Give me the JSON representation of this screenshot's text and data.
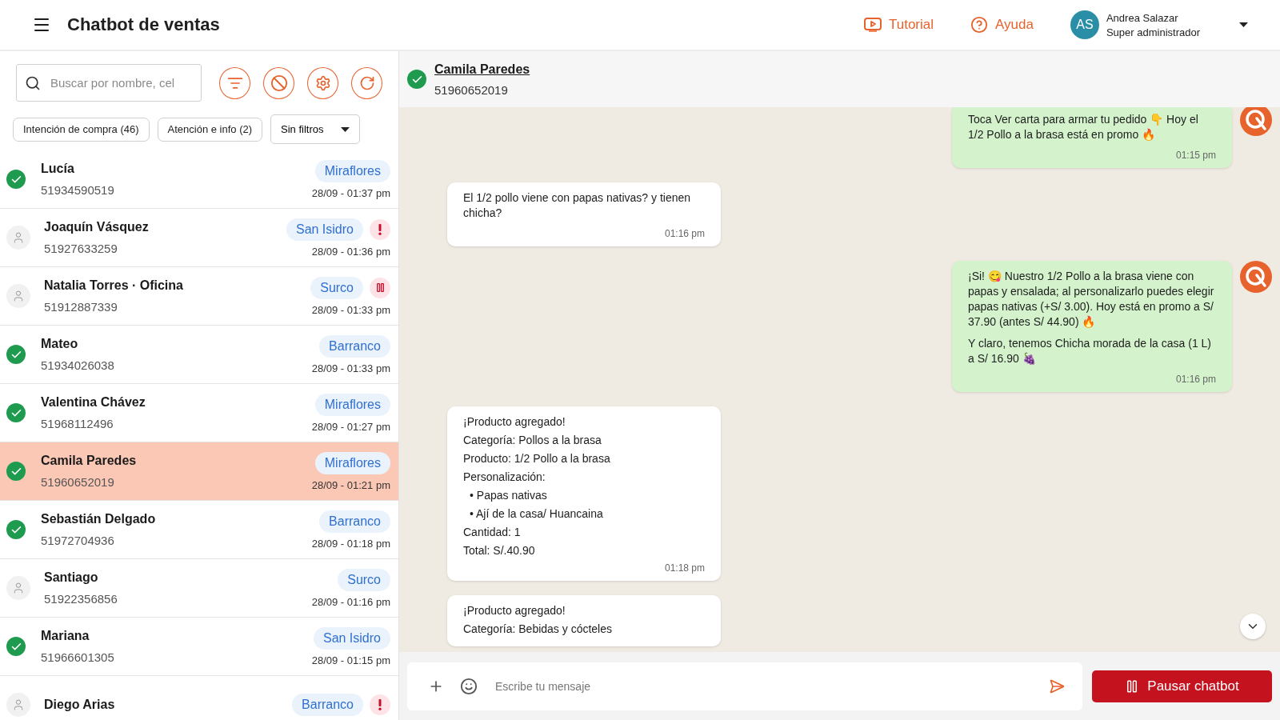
{
  "header": {
    "title": "Chatbot de ventas",
    "links": [
      {
        "kind": "tutorial",
        "label": "Tutorial"
      },
      {
        "kind": "help",
        "label": "Ayuda"
      }
    ],
    "user": {
      "initials": "AS",
      "name": "Andrea Salazar",
      "role": "Super administrador"
    }
  },
  "sidebar": {
    "search": {
      "placeholder": "Buscar por nombre, cel"
    },
    "chips": [
      {
        "label": "Intención de compra (46)"
      },
      {
        "label": "Atención e info (2)"
      }
    ],
    "filter_select": {
      "value": "Sin filtros"
    },
    "contacts": [
      {
        "name": "Lucía",
        "phone": "51934590519",
        "district": "Miraflores",
        "time": "28/09 - 01:37 pm",
        "kind": "bot",
        "alert": false,
        "paused": false,
        "selected": false
      },
      {
        "name": "Joaquín Vásquez",
        "phone": "51927633259",
        "district": "San Isidro",
        "time": "28/09 - 01:36 pm",
        "kind": "human",
        "alert": true,
        "paused": false,
        "selected": false
      },
      {
        "name": "Natalia Torres · Oficina",
        "phone": "51912887339",
        "district": "Surco",
        "time": "28/09 - 01:33 pm",
        "kind": "human",
        "alert": false,
        "paused": true,
        "selected": false
      },
      {
        "name": "Mateo",
        "phone": "51934026038",
        "district": "Barranco",
        "time": "28/09 - 01:33 pm",
        "kind": "bot",
        "alert": false,
        "paused": false,
        "selected": false
      },
      {
        "name": "Valentina Chávez",
        "phone": "51968112496",
        "district": "Miraflores",
        "time": "28/09 - 01:27 pm",
        "kind": "bot",
        "alert": false,
        "paused": false,
        "selected": false
      },
      {
        "name": "Camila Paredes",
        "phone": "51960652019",
        "district": "Miraflores",
        "time": "28/09 - 01:21 pm",
        "kind": "bot",
        "alert": false,
        "paused": false,
        "selected": true
      },
      {
        "name": "Sebastián Delgado",
        "phone": "51972704936",
        "district": "Barranco",
        "time": "28/09 - 01:18 pm",
        "kind": "bot",
        "alert": false,
        "paused": false,
        "selected": false
      },
      {
        "name": "Santiago",
        "phone": "51922356856",
        "district": "Surco",
        "time": "28/09 - 01:16 pm",
        "kind": "human",
        "alert": false,
        "paused": false,
        "selected": false
      },
      {
        "name": "Mariana",
        "phone": "51966601305",
        "district": "San Isidro",
        "time": "28/09 - 01:15 pm",
        "kind": "bot",
        "alert": false,
        "paused": false,
        "selected": false
      },
      {
        "name": "Diego Arias",
        "district": "Barranco",
        "kind": "human",
        "alert": true,
        "paused": false,
        "selected": false
      }
    ]
  },
  "chat": {
    "contact": {
      "name": "Camila Paredes",
      "phone": "51960652019",
      "kind": "bot"
    },
    "messages": [
      {
        "kind": "bot",
        "blocks": [
          {
            "kind": "paragraph",
            "text": "Toca Ver carta para armar tu pedido 👇 Hoy el 1/2 Pollo a la brasa está en promo 🔥"
          }
        ],
        "time": "01:15 pm"
      },
      {
        "kind": "user",
        "blocks": [
          {
            "kind": "paragraph",
            "text": "El 1/2 pollo viene con papas nativas? y tienen chicha?"
          }
        ],
        "time": "01:16 pm"
      },
      {
        "kind": "bot",
        "blocks": [
          {
            "kind": "paragraph",
            "text": "¡Si! 😋 Nuestro 1/2 Pollo a la brasa viene con papas y ensalada; al personalizarlo puedes elegir papas nativas (+S/ 3.00). Hoy está en promo a S/ 37.90 (antes S/ 44.90) 🔥"
          },
          {
            "kind": "paragraph",
            "text": "Y claro, tenemos Chicha morada de la casa (1 L) a S/ 16.90 🍇"
          }
        ],
        "time": "01:16 pm"
      },
      {
        "kind": "user",
        "blocks": [
          {
            "kind": "line",
            "text": "¡Producto agregado!"
          },
          {
            "kind": "line",
            "text": "Categoría: Pollos a la brasa"
          },
          {
            "kind": "line",
            "text": "Producto: 1/2 Pollo a la brasa"
          },
          {
            "kind": "line",
            "text": "Personalización:"
          },
          {
            "kind": "bullet",
            "text": "• Papas nativas"
          },
          {
            "kind": "bullet",
            "text": "• Ají de la casa/ Huancaina"
          },
          {
            "kind": "line",
            "text": "Cantidad: 1"
          },
          {
            "kind": "line",
            "text": "Total: S/.40.90"
          }
        ],
        "time": "01:18 pm"
      },
      {
        "kind": "user",
        "blocks": [
          {
            "kind": "line",
            "text": "¡Producto agregado!"
          },
          {
            "kind": "line",
            "text": "Categoría: Bebidas y cócteles"
          }
        ]
      }
    ],
    "composer": {
      "placeholder": "Escribe tu mensaje"
    },
    "pause_button": {
      "label": "Pausar chatbot"
    }
  }
}
